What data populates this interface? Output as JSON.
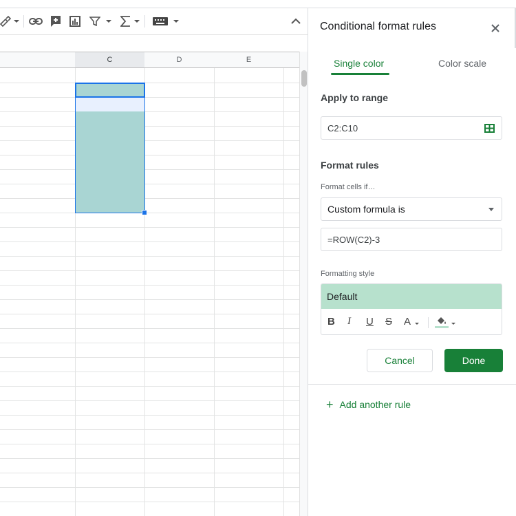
{
  "grid": {
    "columns": [
      "C",
      "D",
      "E"
    ],
    "selected_column": "C"
  },
  "toolbar": {
    "icons": [
      "paint-format-icon",
      "link-icon",
      "insert-comment-icon",
      "insert-chart-icon",
      "filter-icon",
      "functions-icon",
      "input-tools-icon",
      "collapse-icon"
    ]
  },
  "panel": {
    "title": "Conditional format rules",
    "tabs": [
      "Single color",
      "Color scale"
    ],
    "apply_range_label": "Apply to range",
    "range_value": "C2:C10",
    "format_rules_label": "Format rules",
    "format_cells_if_label": "Format cells if…",
    "condition_selected": "Custom formula is",
    "formula_value": "=ROW(C2)-3",
    "formatting_style_label": "Formatting style",
    "style_preview": "Default",
    "cancel_label": "Cancel",
    "done_label": "Done",
    "add_rule_label": "Add another rule"
  },
  "colors": {
    "accent": "#188038",
    "highlight_fill": "#a9d5d3",
    "preview_fill": "#b7e1cd",
    "selection_border": "#1a73e8"
  }
}
